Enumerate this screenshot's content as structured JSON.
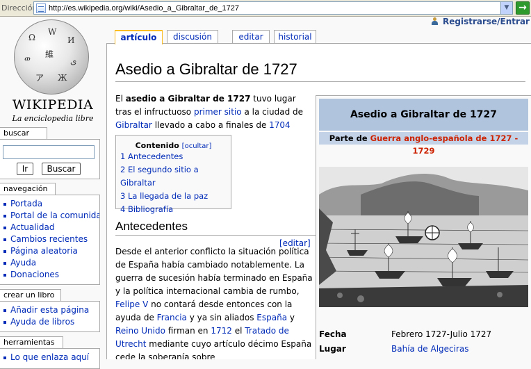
{
  "browser": {
    "address_label": "Dirección",
    "url": "http://es.wikipedia.org/wiki/Asedio_a_Gibraltar_de_1727",
    "go_label": "→"
  },
  "logo": {
    "wordmark": "WIKIPEDIA",
    "tagline": "La enciclopedia libre",
    "glyphs": [
      "Ω",
      "W",
      "И",
      "ወ",
      "維",
      "ی",
      "ア",
      "Ж"
    ]
  },
  "personal": {
    "login": "Registrarse/Entrar"
  },
  "tabs": [
    {
      "label": "artículo",
      "selected": true
    },
    {
      "label": "discusión",
      "selected": false
    },
    {
      "label": "editar",
      "selected": false
    },
    {
      "label": "historial",
      "selected": false
    }
  ],
  "search": {
    "header": "buscar",
    "go_button": "Ir",
    "search_button": "Buscar"
  },
  "navigation": {
    "header": "navegación",
    "items": [
      "Portada",
      "Portal de la comunidad",
      "Actualidad",
      "Cambios recientes",
      "Página aleatoria",
      "Ayuda",
      "Donaciones"
    ]
  },
  "book": {
    "header": "crear un libro",
    "items": [
      "Añadir esta página",
      "Ayuda de libros"
    ]
  },
  "tools": {
    "header": "herramientas",
    "items": [
      "Lo que enlaza aquí"
    ]
  },
  "article": {
    "title": "Asedio a Gibraltar de 1727",
    "intro": {
      "t1": "El ",
      "bold": "asedio a Gibraltar de 1727",
      "t2": " tuvo lugar tras el infructuoso ",
      "l1": "primer sitio",
      "t3": " a la ciudad de ",
      "l2": "Gibraltar",
      "t4": " llevado a cabo a finales de ",
      "l3": "1704"
    },
    "toc": {
      "title": "Contenido",
      "hide": "[ocultar]",
      "items": [
        "1 Antecedentes",
        "2 El segundo sitio a Gibraltar",
        "3 La llegada de la paz",
        "4 Bibliografía"
      ]
    },
    "section1": {
      "heading": "Antecedentes",
      "edit": "[editar]",
      "p1": "Desde el anterior conflicto la situación política de España había cambiado notablemente. La guerra de sucesión había terminado en España y la política internacional cambia de rumbo, ",
      "l_felipe": "Felipe V",
      "p2": " no contará desde entonces con la ayuda de ",
      "l_francia": "Francia",
      "p3": " y ya sin aliados ",
      "l_espana": "España",
      "p4": " y ",
      "l_reino": "Reino Unido",
      "p5": " firman en ",
      "l_1712": "1712",
      "p6": " el ",
      "l_tratado": "Tratado de Utrecht",
      "p7": " mediante cuyo artículo décimo España cede la soberanía sobre"
    }
  },
  "infobox": {
    "title": "Asedio a Gibraltar de 1727",
    "part_prefix": "Parte de ",
    "part_link": "Guerra anglo-española de 1727 - 1729",
    "rows": [
      {
        "key": "Fecha",
        "value": "Febrero 1727-Julio 1727",
        "link": false
      },
      {
        "key": "Lugar",
        "value": "Bahía de Algeciras",
        "link": true
      }
    ]
  }
}
